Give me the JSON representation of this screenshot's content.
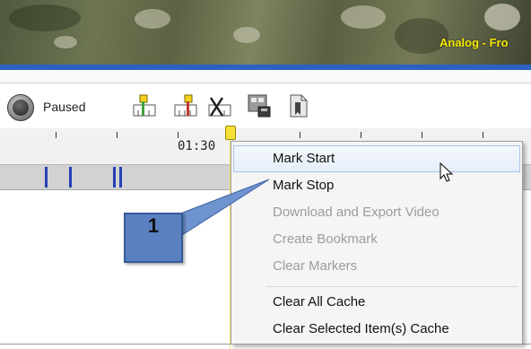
{
  "video": {
    "overlay_text": "Analog - Fro"
  },
  "toolbar": {
    "status_text": "Paused",
    "icons": [
      "stop-icon",
      "mark-start-icon",
      "mark-stop-icon",
      "clear-markers-icon",
      "download-export-video-icon",
      "bookmark-icon"
    ]
  },
  "timeline": {
    "time_label": "01:30"
  },
  "context_menu": {
    "items": [
      {
        "label": "Mark Start",
        "enabled": true
      },
      {
        "label": "Mark Stop",
        "enabled": true
      },
      {
        "label": "Download and Export Video",
        "enabled": false
      },
      {
        "label": "Create Bookmark",
        "enabled": false
      },
      {
        "label": "Clear Markers",
        "enabled": false
      },
      {
        "label": "Clear All Cache",
        "enabled": true
      },
      {
        "label": "Clear Selected Item(s) Cache",
        "enabled": true
      }
    ]
  },
  "callout": {
    "number": "1"
  },
  "colors": {
    "accent_blue": "#2a62c4",
    "overlay_yellow": "#f3e800",
    "callout_blue": "#5b80bf",
    "marker_blue": "#2340b5",
    "playhead_yellow": "#f7e03a"
  }
}
